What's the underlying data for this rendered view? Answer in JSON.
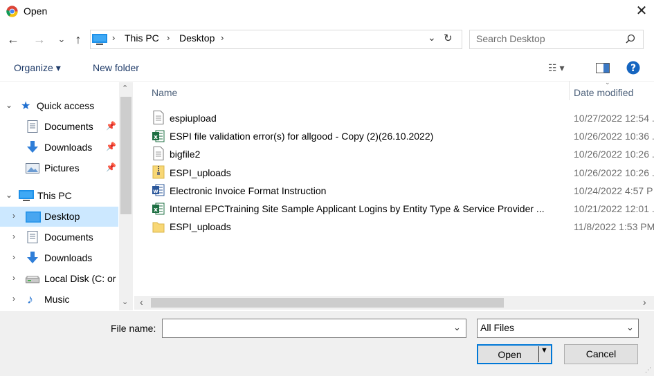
{
  "window": {
    "title": "Open",
    "close_glyph": "✕"
  },
  "nav": {
    "back": "←",
    "forward": "→",
    "recent": "⌄",
    "up": "↑"
  },
  "address": {
    "crumbs": [
      "This PC",
      "Desktop"
    ],
    "sep": "›",
    "dropdown": "⌄",
    "refresh": "↻"
  },
  "search": {
    "placeholder": "Search Desktop",
    "icon": "⌕"
  },
  "toolbar": {
    "organize": "Organize ▾",
    "new_folder": "New folder",
    "view_glyph": "☷ ▾"
  },
  "sidebar": {
    "items": [
      {
        "label": "Quick access",
        "icon": "star-icon",
        "level": 0,
        "expanded": true
      },
      {
        "label": "Documents",
        "icon": "document-icon",
        "level": 1,
        "pinned": true
      },
      {
        "label": "Downloads",
        "icon": "download-icon",
        "level": 1,
        "pinned": true
      },
      {
        "label": "Pictures",
        "icon": "pictures-icon",
        "level": 1,
        "pinned": true
      },
      {
        "label": "This PC",
        "icon": "monitor-icon",
        "level": 0,
        "expanded": true
      },
      {
        "label": "Desktop",
        "icon": "desktop-icon",
        "level": 1,
        "selected": true
      },
      {
        "label": "Documents",
        "icon": "document-icon",
        "level": 1
      },
      {
        "label": "Downloads",
        "icon": "download-icon",
        "level": 1
      },
      {
        "label": "Local Disk (C: or",
        "icon": "drive-icon",
        "level": 1
      },
      {
        "label": "Music",
        "icon": "music-icon",
        "level": 1
      }
    ]
  },
  "list": {
    "columns": {
      "name": "Name",
      "date": "Date modified"
    },
    "files": [
      {
        "name": "espiupload",
        "date": "10/27/2022 12:54 .",
        "icon": "text-file-icon"
      },
      {
        "name": "ESPI file validation error(s) for allgood - Copy (2)(26.10.2022)",
        "date": "10/26/2022 10:36 .",
        "icon": "excel-icon"
      },
      {
        "name": "bigfile2",
        "date": "10/26/2022 10:26 .",
        "icon": "text-file-icon"
      },
      {
        "name": "ESPI_uploads",
        "date": "10/26/2022 10:26 .",
        "icon": "zip-folder-icon"
      },
      {
        "name": "Electronic Invoice Format Instruction",
        "date": "10/24/2022 4:57 P",
        "icon": "word-icon"
      },
      {
        "name": "Internal EPCTraining Site Sample Applicant Logins by Entity Type & Service Provider ...",
        "date": "10/21/2022 12:01 .",
        "icon": "excel-icon"
      },
      {
        "name": "ESPI_uploads",
        "date": "11/8/2022 1:53 PM",
        "icon": "folder-icon"
      }
    ]
  },
  "footer": {
    "file_name_label": "File name:",
    "file_name_value": "",
    "filter": "All Files",
    "open": "Open",
    "cancel": "Cancel"
  },
  "colors": {
    "accent": "#0078d7",
    "selected": "#cce8ff",
    "folder": "#f8d775",
    "excel": "#1d6f42",
    "word": "#2b579a"
  }
}
